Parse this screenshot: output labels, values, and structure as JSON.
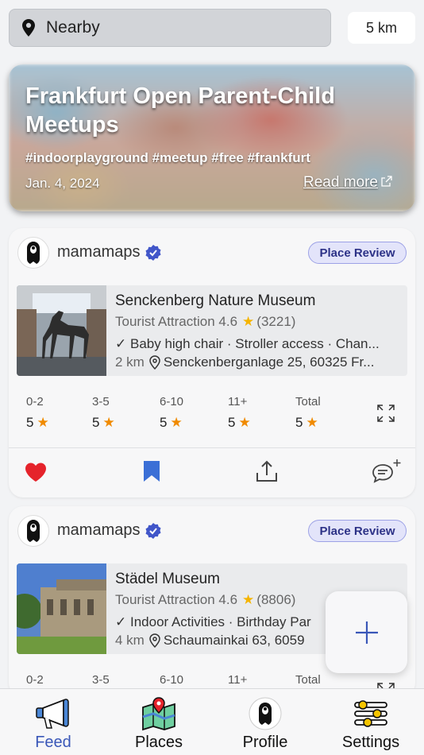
{
  "search": {
    "location_label": "Nearby",
    "distance": "5 km"
  },
  "banner": {
    "title": "Frankfurt Open Parent-Child Meetups",
    "tags": "#indoorplayground #meetup #free #frankfurt",
    "date": "Jan. 4, 2024",
    "read_more": "Read more"
  },
  "posts": [
    {
      "username": "mamamaps",
      "badge": "Place Review",
      "place": {
        "name": "Senckenberg Nature Museum",
        "type": "Tourist Attraction",
        "rating": "4.6",
        "reviews": "(3221)",
        "features": "Baby high chair · Stroller access · Chan...",
        "distance": "2 km",
        "address": "Senckenberganlage 25, 60325 Fr..."
      },
      "ratings": [
        {
          "label": "0-2",
          "value": "5"
        },
        {
          "label": "3-5",
          "value": "5"
        },
        {
          "label": "6-10",
          "value": "5"
        },
        {
          "label": "11+",
          "value": "5"
        },
        {
          "label": "Total",
          "value": "5"
        }
      ]
    },
    {
      "username": "mamamaps",
      "badge": "Place Review",
      "place": {
        "name": "Städel Museum",
        "type": "Tourist Attraction",
        "rating": "4.6",
        "reviews": "(8806)",
        "features": "Indoor Activities · Birthday Par",
        "distance": "4 km",
        "address": "Schaumainkai 63, 6059"
      },
      "ratings": [
        {
          "label": "0-2"
        },
        {
          "label": "3-5"
        },
        {
          "label": "6-10"
        },
        {
          "label": "11+"
        },
        {
          "label": "Total"
        }
      ]
    }
  ],
  "tabs": [
    {
      "label": "Feed",
      "icon": "megaphone-icon",
      "active": true
    },
    {
      "label": "Places",
      "icon": "map-icon"
    },
    {
      "label": "Profile",
      "icon": "profile-avatar-icon"
    },
    {
      "label": "Settings",
      "icon": "sliders-icon"
    }
  ],
  "colors": {
    "accent": "#3a57b8",
    "badge_bg": "#e3e4fa",
    "badge_text": "#2d3287",
    "star": "#f5b400",
    "heart": "#e5232b",
    "bookmark": "#3b6fd6"
  }
}
